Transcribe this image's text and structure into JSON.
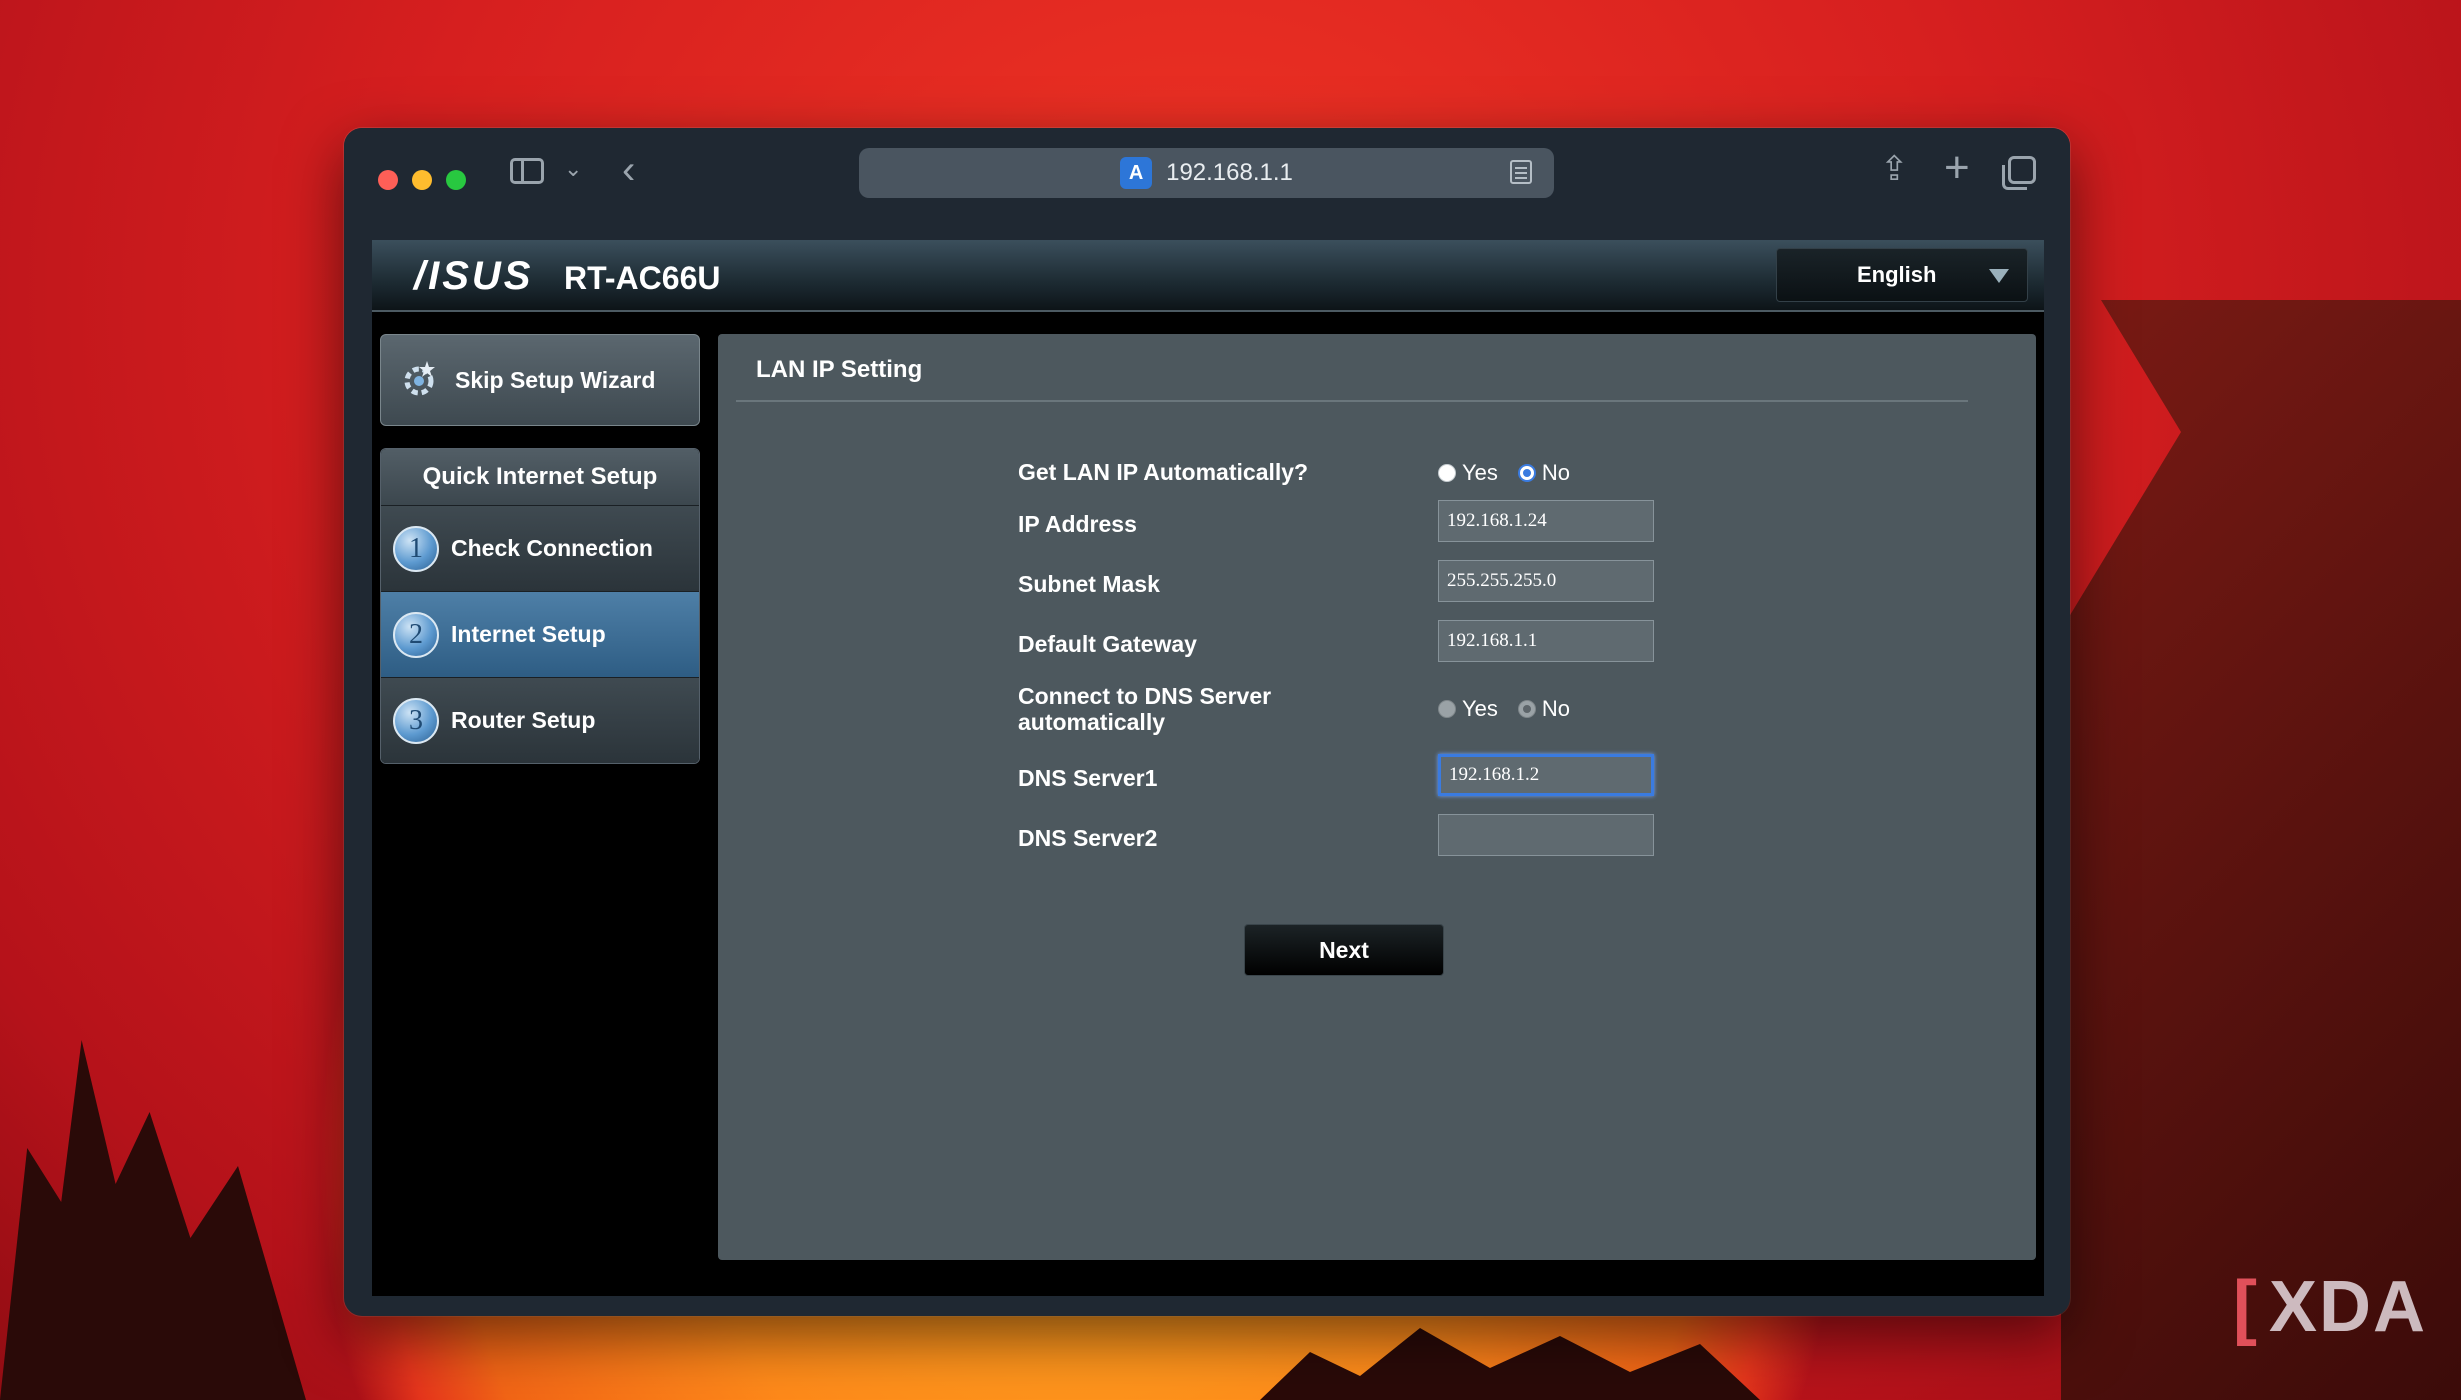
{
  "browser": {
    "url": "192.168.1.1"
  },
  "router": {
    "brand": "/ISUS",
    "model": "RT-AC66U",
    "language": "English"
  },
  "nav": {
    "skip_label": "Skip Setup Wizard",
    "quick_setup_title": "Quick Internet Setup",
    "steps": [
      {
        "num": "1",
        "label": "Check Connection",
        "active": false
      },
      {
        "num": "2",
        "label": "Internet Setup",
        "active": true
      },
      {
        "num": "3",
        "label": "Router Setup",
        "active": false
      }
    ]
  },
  "content": {
    "title": "LAN IP Setting",
    "get_lan_ip_label": "Get LAN IP Automatically?",
    "get_lan_ip_selected": "No",
    "yes_label": "Yes",
    "no_label": "No",
    "ip_label": "IP Address",
    "ip_value": "192.168.1.24",
    "subnet_label": "Subnet Mask",
    "subnet_value": "255.255.255.0",
    "gateway_label": "Default Gateway",
    "gateway_value": "192.168.1.1",
    "dns_auto_label_1": "Connect to DNS Server",
    "dns_auto_label_2": "automatically",
    "dns_auto_selected": "No",
    "dns1_label": "DNS Server1",
    "dns1_value": "192.168.1.2",
    "dns2_label": "DNS Server2",
    "dns2_value": "",
    "next_label": "Next"
  },
  "watermark": {
    "text": "XDA"
  },
  "colors": {
    "accent": "#3a7be0",
    "active_step": "#2e5d84",
    "panel": "#4d585e"
  }
}
